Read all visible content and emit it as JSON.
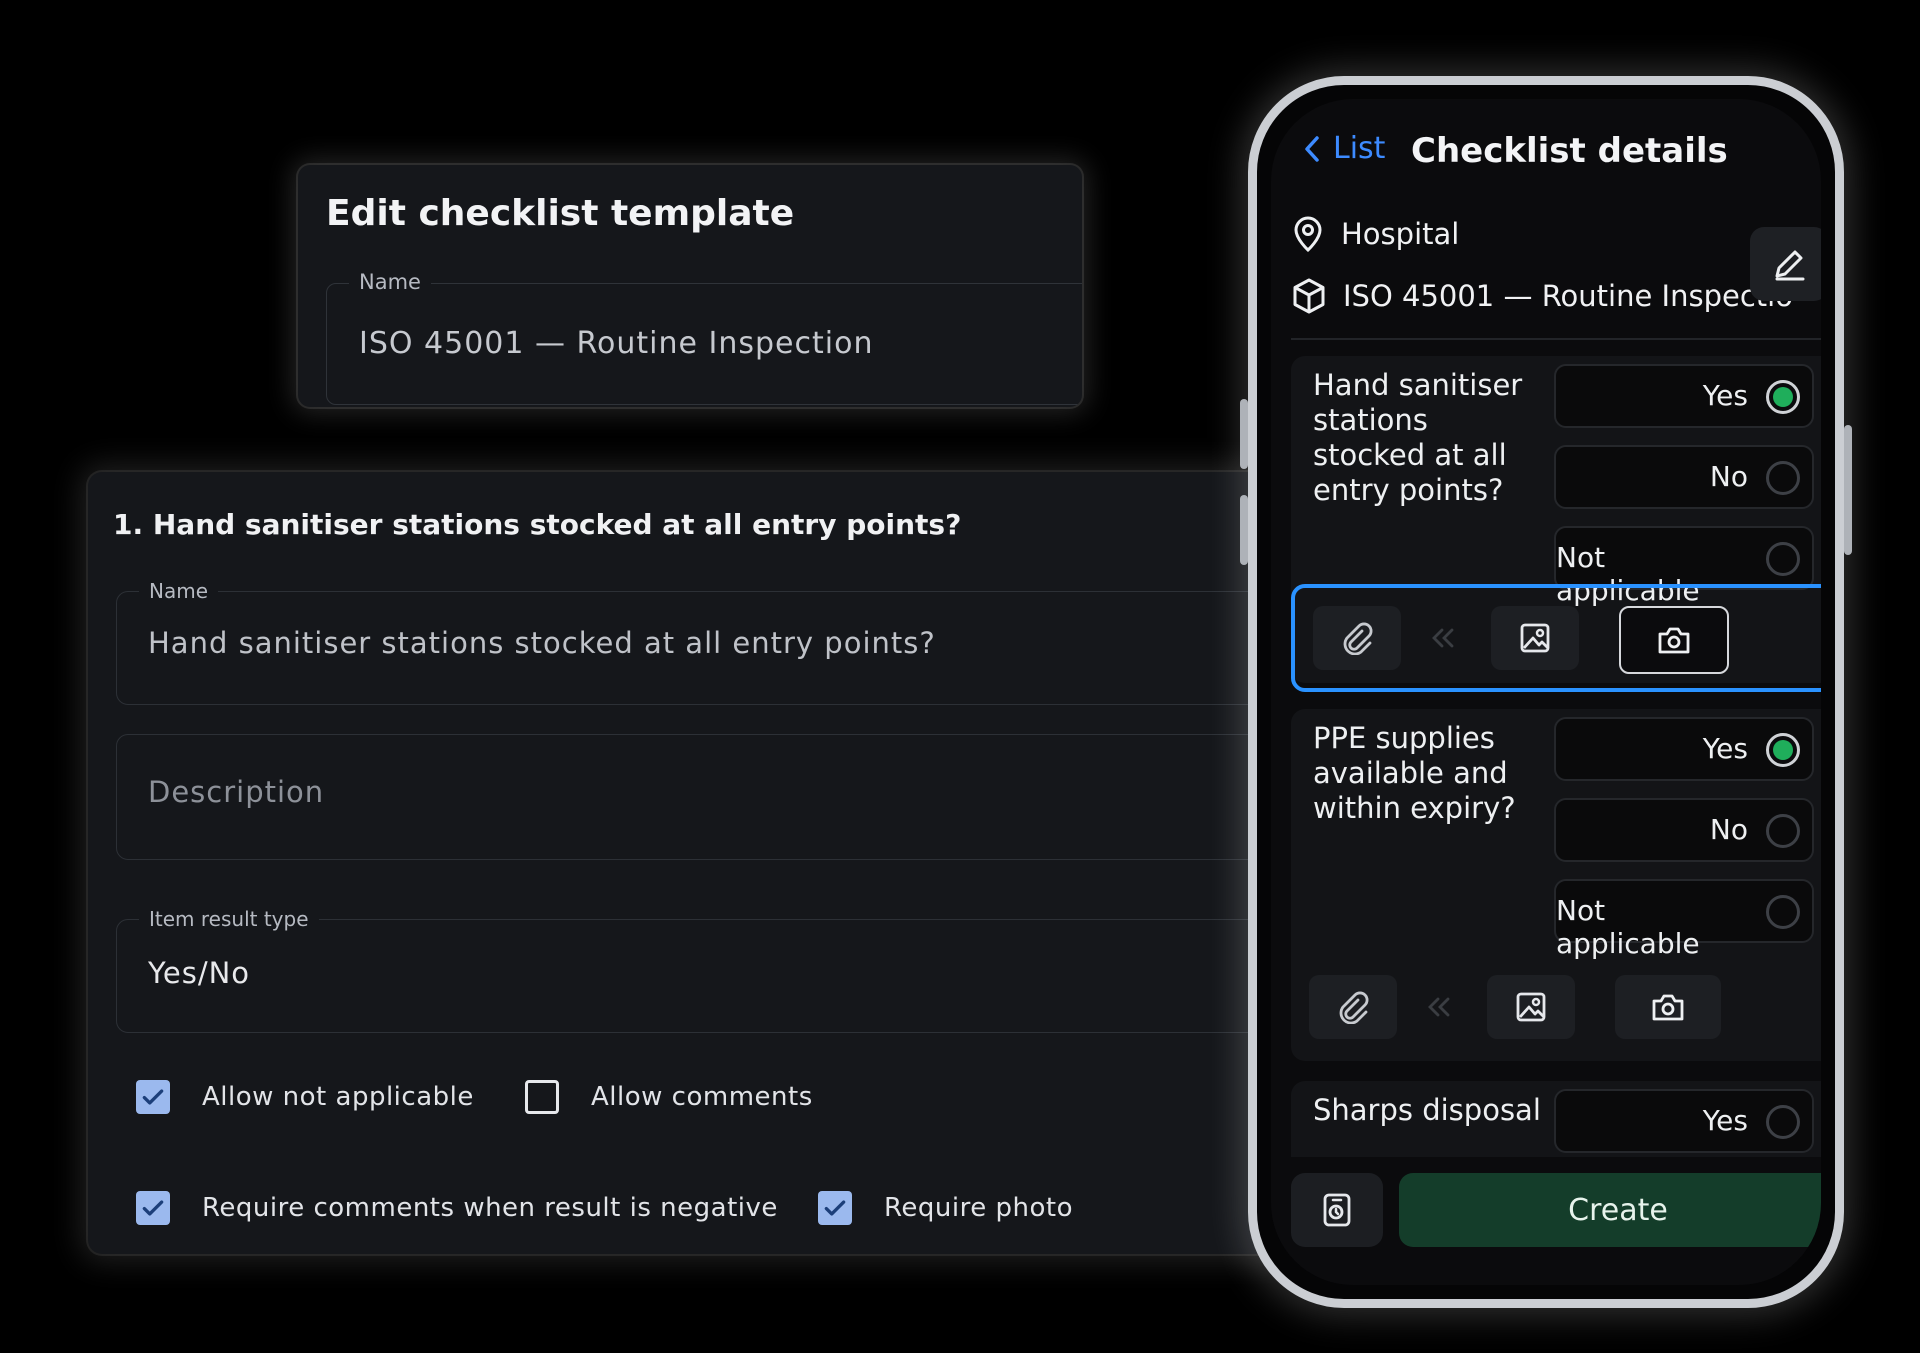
{
  "template_card": {
    "title": "Edit checklist template",
    "name_label": "Name",
    "name_value": "ISO 45001 — Routine Inspection"
  },
  "item_card": {
    "heading": "1. Hand sanitiser stations stocked at all entry points?",
    "name_label": "Name",
    "name_value": "Hand sanitiser stations stocked at all entry points?",
    "description_placeholder": "Description",
    "result_type_label": "Item result type",
    "result_type_value": "Yes/No",
    "checkboxes": [
      {
        "label": "Allow not applicable",
        "checked": true
      },
      {
        "label": "Allow comments",
        "checked": false
      },
      {
        "label": "Require comments when result is negative",
        "checked": true
      },
      {
        "label": "Require photo",
        "checked": true
      }
    ]
  },
  "phone": {
    "back_label": "List",
    "title": "Checklist details",
    "location": "Hospital",
    "template": "ISO 45001 — Routine Inspectio",
    "questions": [
      {
        "text": "Hand sanitiser stations stocked at all entry points?",
        "options": [
          "Yes",
          "No",
          "Not applicable"
        ],
        "selected": "Yes"
      },
      {
        "text": "PPE supplies available and within expiry?",
        "options": [
          "Yes",
          "No",
          "Not applicable"
        ],
        "selected": "Yes"
      },
      {
        "text": "Sharps disposal",
        "options": [
          "Yes"
        ]
      }
    ],
    "create_label": "Create"
  },
  "colors": {
    "accent_blue": "#3d8bff",
    "focus_blue": "#2a92ff",
    "selected_green": "#1fae5b",
    "create_green": "#143d2a",
    "checkbox_blue": "#9bb9ee"
  },
  "icons": [
    "chevron-left-icon",
    "location-pin-icon",
    "cube-icon",
    "pencil-icon",
    "paperclip-icon",
    "double-chevron-left-icon",
    "image-icon",
    "camera-icon",
    "scan-icon",
    "check-icon"
  ]
}
